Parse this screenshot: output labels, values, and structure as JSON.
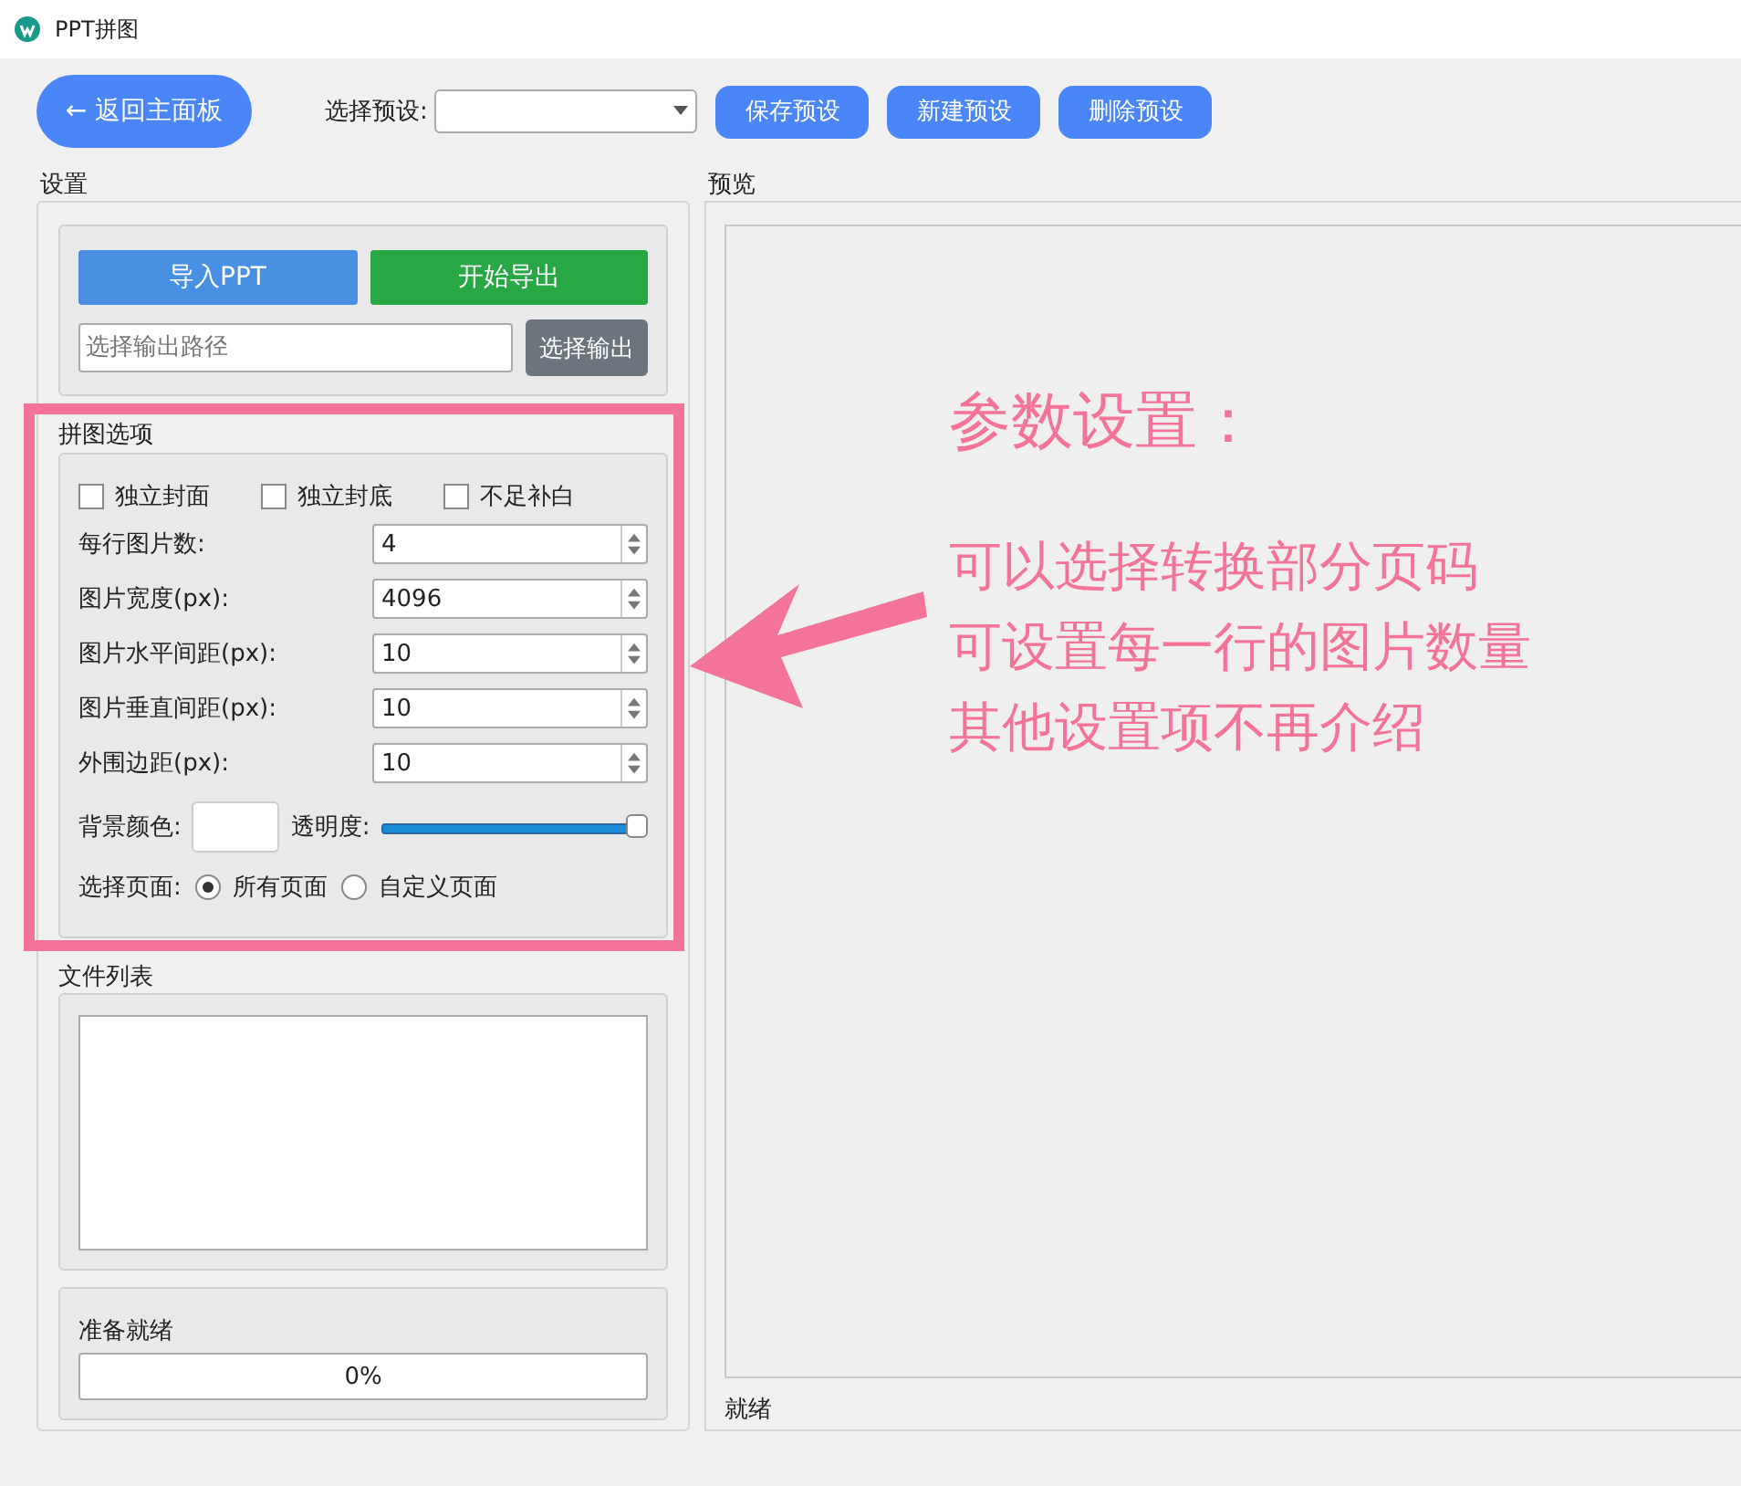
{
  "window": {
    "title": "PPT拼图"
  },
  "toolbar": {
    "back_button": "← 返回主面板",
    "preset_label": "选择预设:",
    "buttons": [
      "保存预设",
      "新建预设",
      "删除预设"
    ]
  },
  "settings": {
    "title": "设置",
    "import_button": "导入PPT",
    "export_button": "开始导出",
    "output_path": {
      "placeholder": "选择输出路径"
    },
    "output_button": "选择输出",
    "options": {
      "title": "拼图选项",
      "checkboxes": [
        {
          "label": "独立封面",
          "checked": false
        },
        {
          "label": "独立封底",
          "checked": false
        },
        {
          "label": "不足补白",
          "checked": false
        }
      ],
      "spinboxes": [
        {
          "label": "每行图片数:",
          "value": "4"
        },
        {
          "label": "图片宽度(px):",
          "value": "4096"
        },
        {
          "label": "图片水平间距(px):",
          "value": "10"
        },
        {
          "label": "图片垂直间距(px):",
          "value": "10"
        },
        {
          "label": "外围边距(px):",
          "value": "10"
        }
      ],
      "background_color_label": "背景颜色:",
      "opacity_label": "透明度:",
      "opacity": {
        "level": 1
      },
      "pages_label": "选择页面:",
      "pages": [
        {
          "label": "所有页面",
          "selected": true
        },
        {
          "label": "自定义页面",
          "selected": false
        }
      ]
    },
    "file_list_title": "文件列表",
    "status": "准备就绪",
    "progress": {
      "level": 0,
      "reading": "0%"
    }
  },
  "preview": {
    "title": "预览",
    "status": "就绪"
  },
  "annotation": {
    "title": "参数设置：",
    "lines": [
      "可以选择转换部分页码",
      "可设置每一行的图片数量",
      "其他设置项不再介绍"
    ]
  }
}
